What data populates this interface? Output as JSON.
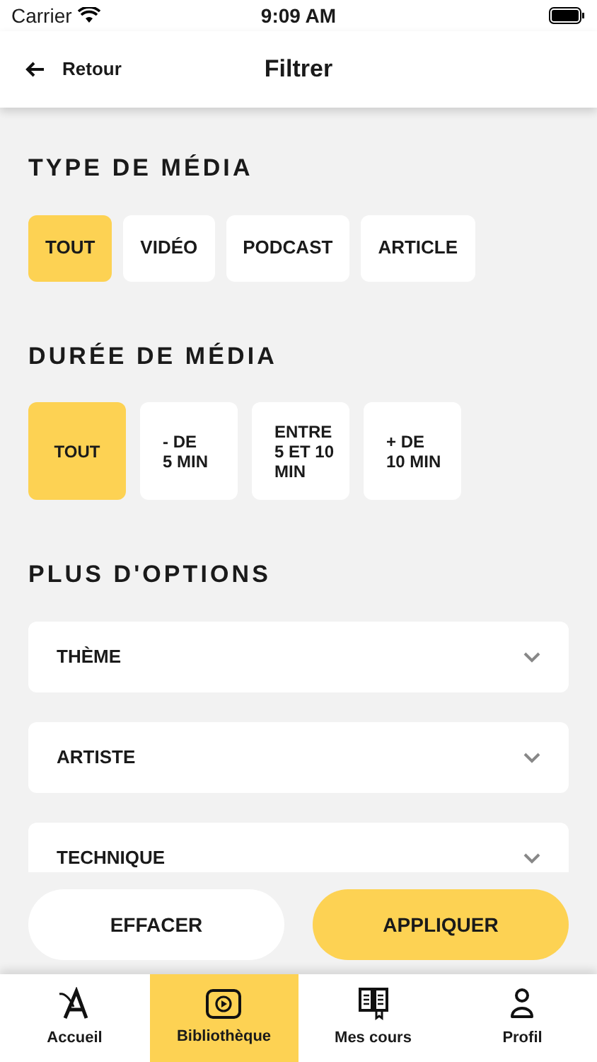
{
  "status_bar": {
    "carrier": "Carrier",
    "time": "9:09 AM"
  },
  "header": {
    "back": "Retour",
    "title": "Filtrer"
  },
  "media_type": {
    "title": "TYPE DE MÉDIA",
    "options": [
      {
        "label": "TOUT",
        "selected": true
      },
      {
        "label": "VIDÉO",
        "selected": false
      },
      {
        "label": "PODCAST",
        "selected": false
      },
      {
        "label": "ARTICLE",
        "selected": false
      }
    ]
  },
  "media_duration": {
    "title": "DURÉE DE MÉDIA",
    "options": [
      {
        "label": "TOUT",
        "selected": true
      },
      {
        "label": "- DE\n5 MIN",
        "selected": false
      },
      {
        "label": "ENTRE\n5 ET 10\nMIN",
        "selected": false
      },
      {
        "label": "+ DE\n10 MIN",
        "selected": false
      }
    ]
  },
  "more_options": {
    "title": "PLUS D'OPTIONS",
    "dropdowns": [
      {
        "label": "THÈME"
      },
      {
        "label": "ARTISTE"
      },
      {
        "label": "TECHNIQUE"
      }
    ]
  },
  "actions": {
    "clear": "EFFACER",
    "apply": "APPLIQUER"
  },
  "tab_bar": [
    {
      "label": "Accueil",
      "selected": false
    },
    {
      "label": "Bibliothèque",
      "selected": true
    },
    {
      "label": "Mes cours",
      "selected": false
    },
    {
      "label": "Profil",
      "selected": false
    }
  ]
}
